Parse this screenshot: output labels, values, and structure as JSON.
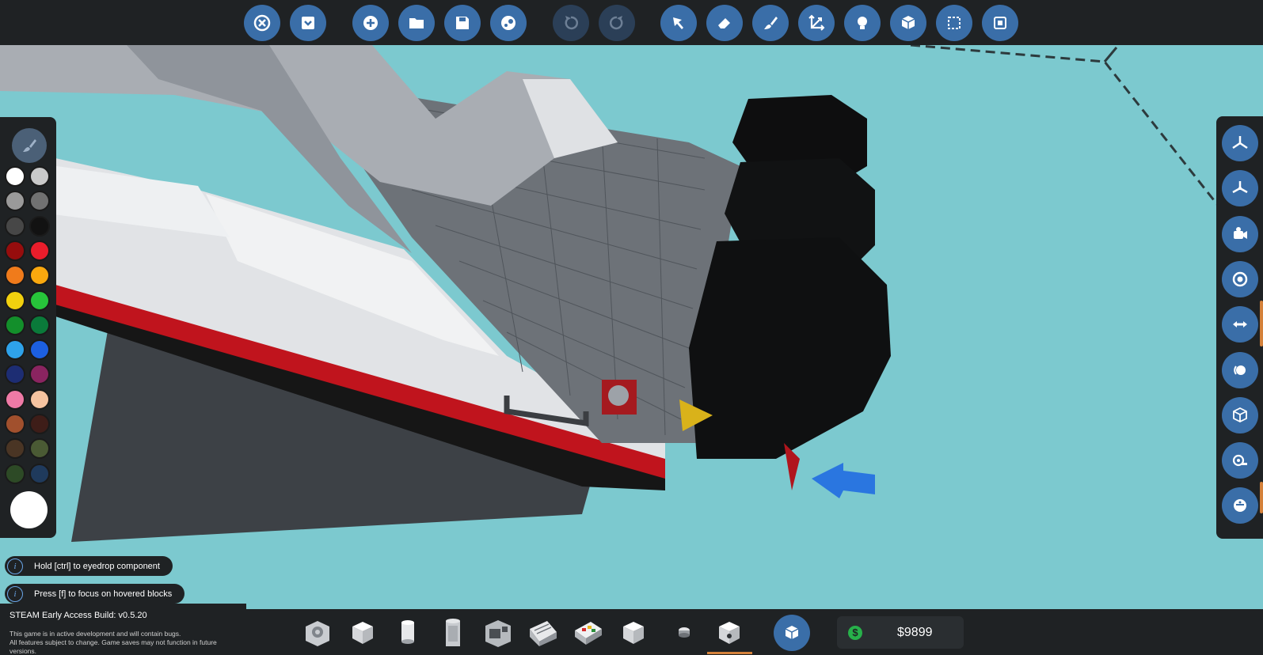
{
  "toolbar": {
    "buttons": [
      {
        "name": "close",
        "icon": "close-icon"
      },
      {
        "name": "dock",
        "icon": "dock-icon"
      },
      {
        "name": "new",
        "icon": "plus-icon"
      },
      {
        "name": "open",
        "icon": "folder-icon"
      },
      {
        "name": "save",
        "icon": "save-icon"
      },
      {
        "name": "steam-workshop",
        "icon": "steam-icon"
      },
      {
        "name": "undo",
        "icon": "undo-icon",
        "disabled": true
      },
      {
        "name": "redo",
        "icon": "redo-icon",
        "disabled": true
      },
      {
        "name": "select",
        "icon": "cursor-icon"
      },
      {
        "name": "erase",
        "icon": "eraser-icon"
      },
      {
        "name": "paint",
        "icon": "paint-brush-icon"
      },
      {
        "name": "move",
        "icon": "move-axes-icon"
      },
      {
        "name": "logic",
        "icon": "lightbulb-icon"
      },
      {
        "name": "components",
        "icon": "components-icon"
      },
      {
        "name": "selection",
        "icon": "selection-box-icon"
      },
      {
        "name": "chip",
        "icon": "chip-icon"
      }
    ]
  },
  "palette": {
    "colors": [
      "#ffffff",
      "#c9c9c9",
      "#9a9a9a",
      "#717171",
      "#474747",
      "#121212",
      "#960d0d",
      "#ea1d2b",
      "#f07b1b",
      "#f9a80e",
      "#f2d10e",
      "#27c43a",
      "#138f2b",
      "#0a7a3a",
      "#2ea2ea",
      "#1c5fe0",
      "#1d2d73",
      "#8a2460",
      "#ef7aa6",
      "#f6c3a0",
      "#a1502d",
      "#3e1d18",
      "#4a3524",
      "#4a5a34",
      "#2d4a26",
      "#1f3a5c"
    ],
    "selected_color": "#ffffff"
  },
  "right_panel": {
    "buttons": [
      {
        "name": "view-top",
        "icon": "axis-top-icon"
      },
      {
        "name": "view-axes",
        "icon": "axis-front-icon"
      },
      {
        "name": "camera",
        "icon": "camera-icon"
      },
      {
        "name": "focus",
        "icon": "target-icon"
      },
      {
        "name": "flip",
        "icon": "flip-arrows-icon"
      },
      {
        "name": "rotate",
        "icon": "rotate-icon"
      },
      {
        "name": "block-view",
        "icon": "cube-outline-icon"
      },
      {
        "name": "measure",
        "icon": "tape-measure-icon"
      },
      {
        "name": "mass",
        "icon": "weight-icon"
      }
    ]
  },
  "hints": {
    "eyedrop": "Hold [ctrl] to eyedrop component",
    "focus": "Press [f] to focus on hovered blocks"
  },
  "build": {
    "title": "STEAM Early Access Build: v0.5.20",
    "note_line1": "This game is in active development and will contain bugs.",
    "note_line2": "All features subject to change. Game saves may not function in future versions."
  },
  "inventory": {
    "items": [
      {
        "name": "component-1",
        "icon": "gear-block-icon"
      },
      {
        "name": "component-2",
        "icon": "white-block-icon"
      },
      {
        "name": "component-3",
        "icon": "cylinder-icon"
      },
      {
        "name": "component-4",
        "icon": "tall-cylinder-icon"
      },
      {
        "name": "component-5",
        "icon": "machine-block-icon"
      },
      {
        "name": "component-6",
        "icon": "slope-block-icon"
      },
      {
        "name": "component-7",
        "icon": "circuit-block-icon"
      },
      {
        "name": "component-8",
        "icon": "white-block-icon"
      },
      {
        "name": "component-9",
        "icon": "small-part-icon"
      },
      {
        "name": "component-10",
        "icon": "socket-block-icon",
        "selected": true
      }
    ],
    "category_icon": "components-icon"
  },
  "money": {
    "amount": "$9899",
    "icon": "dollar-coin-icon"
  }
}
